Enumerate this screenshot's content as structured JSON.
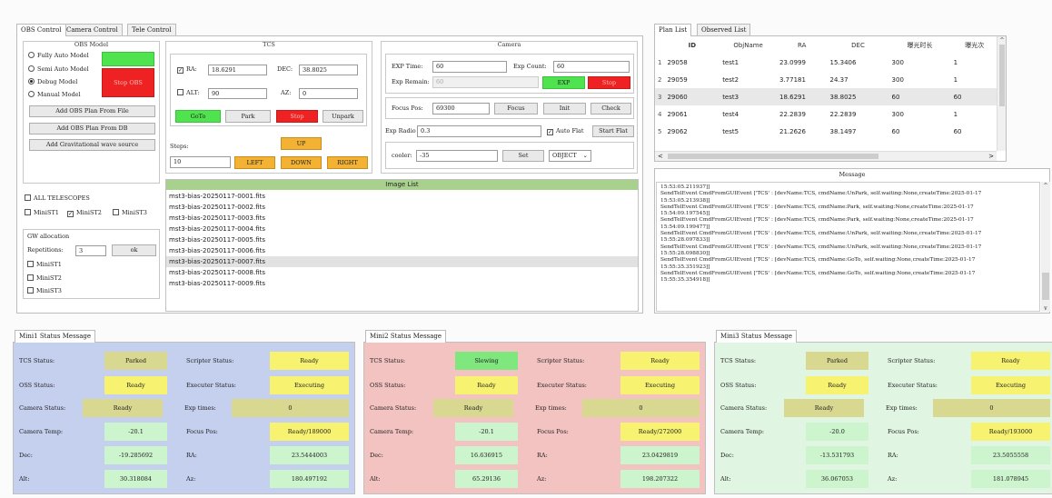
{
  "left_tabs": [
    "OBS Control",
    "Camera Control",
    "Tele Control"
  ],
  "obs_model": {
    "title": "OBS Model",
    "options": [
      "Fully Auto Model",
      "Semi Auto Model",
      "Debug Model",
      "Manual Model"
    ],
    "selected_index": 2,
    "buttons": [
      "Add OBS Plan From File",
      "Add OBS Plan From DB",
      "Add  Gravitational wave source"
    ],
    "start_label": "",
    "stop_label": "",
    "red_label": "Stop OBS"
  },
  "telescopes": {
    "all_label": "ALL TELESCOPES",
    "items": [
      {
        "label": "MiniST1",
        "checked": false
      },
      {
        "label": "MiniST2",
        "checked": true
      },
      {
        "label": "MiniST3",
        "checked": false
      }
    ]
  },
  "gw": {
    "title": "GW allocation",
    "rep_label": "Repetitions:",
    "rep_value": "3",
    "ok_label": "ok",
    "items": [
      "MiniST1",
      "MiniST2",
      "MiniST3"
    ]
  },
  "tcs": {
    "title": "TCS",
    "ra_label": "RA:",
    "ra_value": "18.6291",
    "dec_label": "DEC:",
    "dec_value": "38.8025",
    "alt_label": "ALT:",
    "alt_value": "90",
    "az_label": "AZ:",
    "az_value": "0",
    "goto": "GoTo",
    "park": "Park",
    "stop": "Stop",
    "unpark": "Unpark",
    "steps_label": "Steps:",
    "steps_value": "10",
    "up": "UP",
    "left": "LEFT",
    "down": "DOWN",
    "right": "RIGHT"
  },
  "camera": {
    "title": "Camera",
    "exp_time_label": "EXP Time:",
    "exp_time_value": "60",
    "exp_count_label": "Exp Count:",
    "exp_count_value": "60",
    "exp_remain_label": "Exp Remain:",
    "exp_remain_value": "60",
    "exp_btn": "EXP",
    "stop_btn": "Stop",
    "focus_label": "Focus Pos:",
    "focus_value": "69300",
    "focus_btn": "Focus",
    "init_btn": "Init",
    "check_btn": "Check",
    "ratio_label": "Exp Radio",
    "ratio_value": "0.3",
    "auto_flat_label": "Auto Flat",
    "start_flat_btn": "Start Flat",
    "cooler_label": "cooler:",
    "cooler_value": "-35",
    "set_btn": "Set",
    "type_value": "OBJECT"
  },
  "image_list": {
    "title": "Image List",
    "items": [
      "mst3-bias-20250117-0001.fits",
      "mst3-bias-20250117-0002.fits",
      "mst3-bias-20250117-0003.fits",
      "mst3-bias-20250117-0004.fits",
      "mst3-bias-20250117-0005.fits",
      "mst3-bias-20250117-0006.fits",
      "mst3-bias-20250117-0007.fits",
      "mst3-bias-20250117-0008.fits",
      "mst3-bias-20250117-0009.fits"
    ],
    "selected_index": 6
  },
  "plan_tabs": [
    "Plan List",
    "Observed List"
  ],
  "plan_table": {
    "headers": [
      "ID",
      "ObjName",
      "RA",
      "DEC",
      "曝光时长",
      "曝光次"
    ],
    "rows": [
      [
        "1",
        "29058",
        "test1",
        "23.0999",
        "15.3406",
        "300",
        "1"
      ],
      [
        "2",
        "29059",
        "test2",
        "3.77181",
        "24.37",
        "300",
        "1"
      ],
      [
        "3",
        "29060",
        "test3",
        "18.6291",
        "38.8025",
        "60",
        "60"
      ],
      [
        "4",
        "29061",
        "test4",
        "22.2839",
        "22.2839",
        "300",
        "1"
      ],
      [
        "5",
        "29062",
        "test5",
        "21.2626",
        "38.1497",
        "60",
        "60"
      ]
    ]
  },
  "message": {
    "title": "Message",
    "lines": [
      "15:53:05.211937]]",
      "SendTelEvent CmdFromGUIEvent ['TCS' : [devName:TCS, cmdName:UnPark, self.waiting:None,createTime:2025-01-17",
      "15:53:05.213938]]",
      "SendTelEvent CmdFromGUIEvent ['TCS' : [devName:TCS, cmdName:Park, self.waiting:None,createTime:2025-01-17",
      "15:54:09.197545]]",
      "SendTelEvent CmdFromGUIEvent ['TCS' : [devName:TCS, cmdName:Park, self.waiting:None,createTime:2025-01-17",
      "15:54:09.199477]]",
      "SendTelEvent CmdFromGUIEvent ['TCS' : [devName:TCS, cmdName:UnPark, self.waiting:None,createTime:2025-01-17",
      "15:55:28.097833]]",
      "SendTelEvent CmdFromGUIEvent ['TCS' : [devName:TCS, cmdName:UnPark, self.waiting:None,createTime:2025-01-17",
      "15:55:28.098830]]",
      "SendTelEvent CmdFromGUIEvent ['TCS' : [devName:TCS, cmdName:GoTo, self.waiting:None,createTime:2025-01-17",
      "15:55:35.351923]]",
      "SendTelEvent CmdFromGUIEvent ['TCS' : [devName:TCS, cmdName:GoTo, self.waiting:None,createTime:2025-01-17",
      "15:55:35.354918]]"
    ]
  },
  "labels": {
    "tcs_status": "TCS Status:",
    "scripter_status": "Scripter Status:",
    "oss_status": "OSS Status:",
    "executer_status": "Executer Status:",
    "camera_status": "Camera Status:",
    "exp_times": "Exp times:",
    "camera_temp": "Camera Temp:",
    "focus_pos": "Focus Pos:",
    "dec": "Dec:",
    "ra": "RA:",
    "alt": "Alt:",
    "az": "Az:"
  },
  "status_panels": [
    {
      "tab": "Mini1 Status Message",
      "bg": "#c5cfee",
      "tcs": "Parked",
      "scripter": "Ready",
      "oss": "Ready",
      "executer": "Executing",
      "camera": "Ready",
      "exp_times": "0",
      "temp": "-20.1",
      "focus": "Ready/189000",
      "dec": "-19.285692",
      "ra": "23.5444003",
      "alt": "30.318084",
      "az": "180.497192",
      "tcs_color": "#d8d890"
    },
    {
      "tab": "Mini2 Status Message",
      "bg": "#f2c3c0",
      "tcs": "Slewing",
      "scripter": "Ready",
      "oss": "Ready",
      "executer": "Executing",
      "camera": "Ready",
      "exp_times": "0",
      "temp": "-20.1",
      "focus": "Ready/272000",
      "dec": "16.636915",
      "ra": "23.0429819",
      "alt": "65.29136",
      "az": "198.207322",
      "tcs_color": "#7ee87e"
    },
    {
      "tab": "Mini3 Status Message",
      "bg": "#e0f5e2",
      "tcs": "Parked",
      "scripter": "Ready",
      "oss": "Ready",
      "executer": "Executing",
      "camera": "Ready",
      "exp_times": "0",
      "temp": "-20.0",
      "focus": "Ready/193000",
      "dec": "-13.531793",
      "ra": "23.5055558",
      "alt": "36.067053",
      "az": "181.078945",
      "tcs_color": "#d8d890"
    }
  ],
  "colors": {
    "yellow": "#f7f370",
    "amber": "#f3b233",
    "green": "#4fe34f",
    "red": "#ee2222",
    "olive": "#d8d890",
    "lightgreen": "#cdf5cd"
  }
}
